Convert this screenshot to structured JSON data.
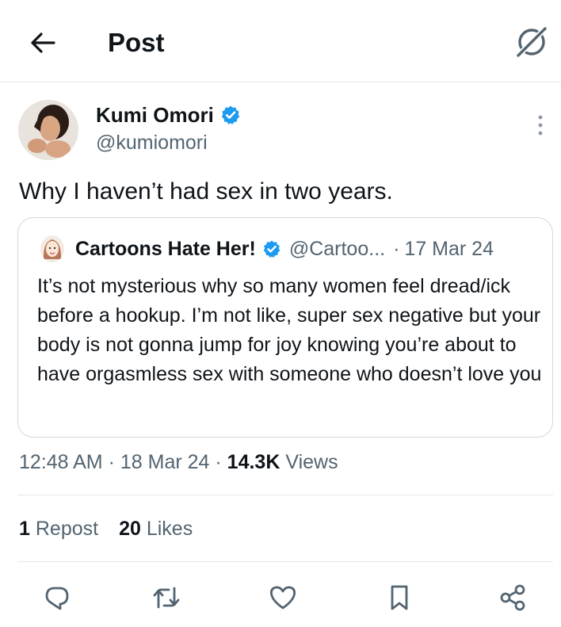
{
  "header": {
    "title": "Post",
    "back_icon": "arrow-left-icon",
    "grok_icon": "grok-icon"
  },
  "post": {
    "author_name": "Kumi Omori",
    "author_handle": "@kumiomori",
    "verified": true,
    "text": "Why I haven’t had sex in two years.",
    "quoted": {
      "author_name": "Cartoons Hate Her!",
      "author_handle": "@Cartoo...",
      "separator": "·",
      "date": "17 Mar 24",
      "verified": true,
      "text": "It’s not mysterious why so many women feel dread/ick before a hookup. I’m not like, super sex negative but your body is not gonna jump for joy knowing you’re about to have orgasmless sex with someone who doesn’t love you"
    },
    "meta": {
      "time": "12:48 AM",
      "sep1": "·",
      "date": "18 Mar 24",
      "sep2": "·",
      "views_count": "14.3K",
      "views_label": "Views"
    },
    "stats": {
      "reposts_count": "1",
      "reposts_label": "Repost",
      "likes_count": "20",
      "likes_label": "Likes"
    }
  },
  "actions": [
    "reply-icon",
    "repost-icon",
    "like-icon",
    "bookmark-icon",
    "share-icon"
  ],
  "colors": {
    "text": "#0f1419",
    "secondary": "#536471",
    "verified": "#1d9bf0",
    "divider": "#e6e8ea"
  }
}
